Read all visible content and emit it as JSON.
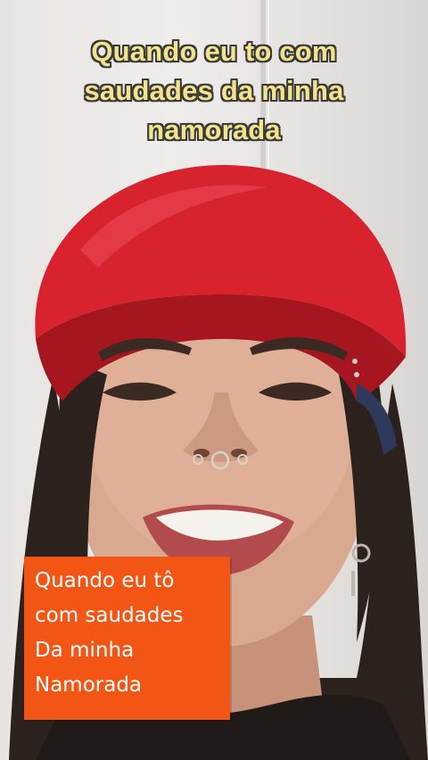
{
  "overlay": {
    "top_caption_lines": [
      "Quando eu to com",
      "saudades da minha",
      "namorada"
    ],
    "box_caption_lines": [
      "Quando eu tô",
      "com saudades",
      "Da minha",
      "Namorada"
    ],
    "top_caption_color": "#f3e38a",
    "box_color": "#f35515"
  },
  "photo": {
    "subject": "woman-wearing-red-cap-smiling",
    "colors": {
      "cap": "#d8232f",
      "cap_shadow": "#a5161f",
      "hair": "#2b211d",
      "skin": "#d9a98f",
      "wall": "#ebe8e6"
    }
  }
}
